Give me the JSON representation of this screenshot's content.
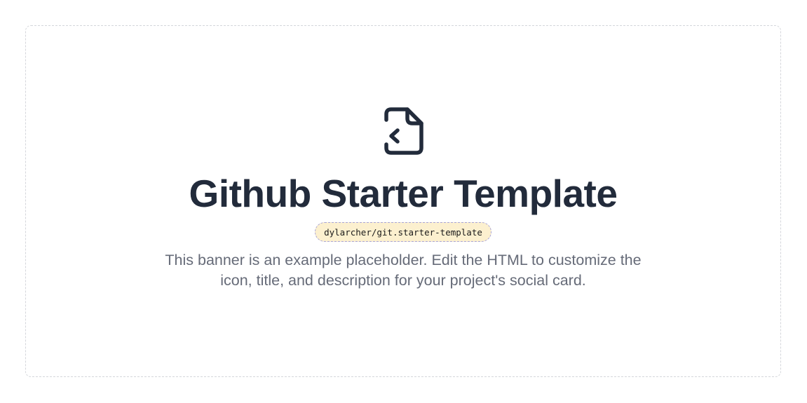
{
  "banner": {
    "icon": "file-with-chevron-icon",
    "title": "Github Starter Template",
    "repo": "dylarcher/git.starter-template",
    "description": "This banner is an example placeholder. Edit the HTML to customize the icon, title, and description for your project's social card."
  },
  "colors": {
    "title": "#222b3b",
    "text": "#666b78",
    "badge_bg": "#fcf0cf",
    "badge_border": "#a8a4d6",
    "card_border": "#d4d6db"
  }
}
